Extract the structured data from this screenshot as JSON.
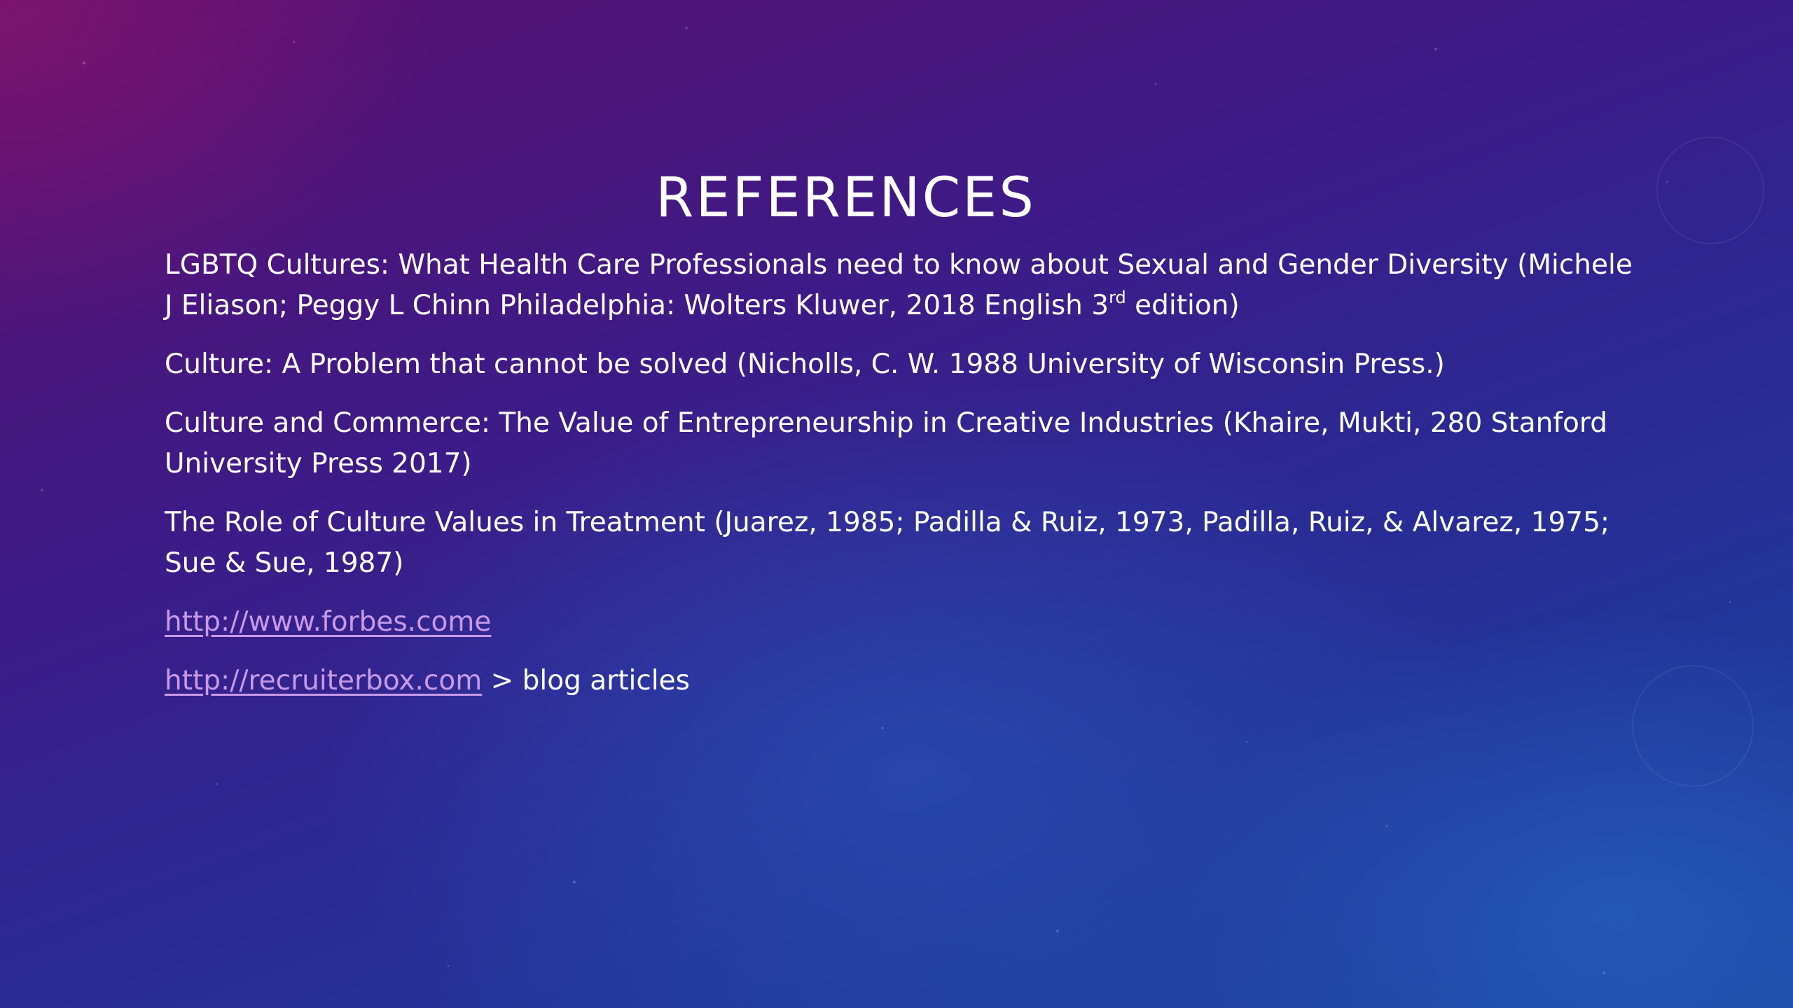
{
  "slide": {
    "title": "REFERENCES",
    "references": [
      {
        "before_sup": "LGBTQ Cultures: What Health Care Professionals need to know about Sexual and Gender Diversity (Michele J Eliason; Peggy L Chinn Philadelphia: Wolters Kluwer, 2018 English 3",
        "sup": "rd",
        "after_sup": " edition)"
      },
      {
        "text": "Culture: A Problem that cannot be solved (Nicholls, C. W. 1988 University of Wisconsin Press.)"
      },
      {
        "text": "Culture and Commerce: The Value of Entrepreneurship in Creative Industries (Khaire, Mukti, 280 Stanford University Press 2017)"
      },
      {
        "text": "The Role of Culture Values in Treatment (Juarez, 1985; Padilla & Ruiz, 1973, Padilla, Ruiz, & Alvarez, 1975; Sue & Sue, 1987)"
      }
    ],
    "links": [
      {
        "url": "http://www.forbes.come",
        "suffix": ""
      },
      {
        "url": "http://recruiterbox.com",
        "suffix": " > blog articles"
      }
    ]
  },
  "colors": {
    "text": "#ffffff",
    "link": "#c89ae8",
    "background_top": "#5a1070",
    "background_bottom": "#1d4aa4"
  }
}
